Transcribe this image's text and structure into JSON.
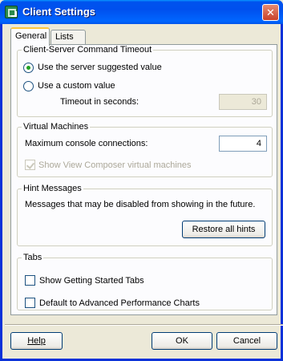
{
  "window": {
    "title": "Client Settings",
    "close_glyph": "✕"
  },
  "tabs": [
    {
      "label": "General"
    },
    {
      "label": "Lists"
    }
  ],
  "timeout_group": {
    "legend": "Client-Server Command Timeout",
    "option_server": "Use the server suggested value",
    "option_custom": "Use a custom value",
    "timeout_label": "Timeout in seconds:",
    "timeout_value": "30",
    "selected": "server"
  },
  "vm_group": {
    "legend": "Virtual Machines",
    "max_connections_label": "Maximum console connections:",
    "max_connections_value": "4",
    "view_composer_label": "Show View Composer virtual machines",
    "view_composer_checked": true,
    "view_composer_disabled": true
  },
  "hint_group": {
    "legend": "Hint Messages",
    "description": "Messages that may be disabled from showing in the future.",
    "restore_label": "Restore all hints"
  },
  "tabs_group": {
    "legend": "Tabs",
    "getting_started_label": "Show Getting Started Tabs",
    "getting_started_checked": false,
    "advanced_perf_label": "Default to Advanced Performance Charts",
    "advanced_perf_checked": false
  },
  "footer": {
    "help_label": "Help",
    "ok_label": "OK",
    "cancel_label": "Cancel"
  },
  "icons": {
    "app": "vsphere-client-icon",
    "close": "close-icon"
  },
  "colors": {
    "titlebar": "#0054e3",
    "window_bg": "#ece9d8",
    "panel_bg": "#fcfcfe",
    "accent_tab": "#ffc83c"
  }
}
